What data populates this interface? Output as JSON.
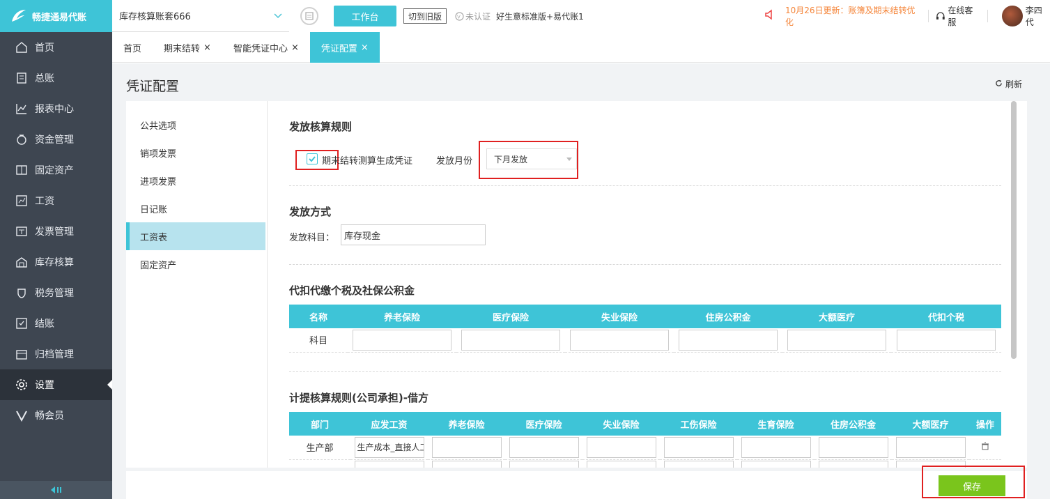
{
  "sidebar": {
    "logo_text": "畅捷通易代账",
    "items": [
      {
        "label": "首页",
        "icon": "home-icon"
      },
      {
        "label": "总账",
        "icon": "ledger-icon"
      },
      {
        "label": "报表中心",
        "icon": "chart-icon"
      },
      {
        "label": "资金管理",
        "icon": "money-bag-icon"
      },
      {
        "label": "固定资产",
        "icon": "asset-icon"
      },
      {
        "label": "工资",
        "icon": "salary-icon"
      },
      {
        "label": "发票管理",
        "icon": "invoice-icon"
      },
      {
        "label": "库存核算",
        "icon": "warehouse-icon"
      },
      {
        "label": "税务管理",
        "icon": "tax-icon"
      },
      {
        "label": "结账",
        "icon": "closing-icon"
      },
      {
        "label": "归档管理",
        "icon": "archive-icon"
      },
      {
        "label": "设置",
        "icon": "gear-icon"
      },
      {
        "label": "畅会员",
        "icon": "vip-icon"
      }
    ],
    "active_index": 11
  },
  "topbar": {
    "account_name": "库存核算账套666",
    "workbench_label": "工作台",
    "switch_old_label": "切到旧版",
    "unverified": "未认证",
    "plan": "好生意标准版+易代账1",
    "notice": "10月26日更新：账簿及期末结转优化",
    "online_service": "在线客服",
    "user_name": "李四代"
  },
  "tabs": [
    {
      "label": "首页",
      "closable": false
    },
    {
      "label": "期末结转",
      "closable": true
    },
    {
      "label": "智能凭证中心",
      "closable": true
    },
    {
      "label": "凭证配置",
      "closable": true,
      "active": true
    }
  ],
  "tab_close": "×",
  "page": {
    "title": "凭证配置",
    "refresh_label": "刷新"
  },
  "left_menu": [
    "公共选项",
    "销项发票",
    "进项发票",
    "日记账",
    "工资表",
    "固定资产"
  ],
  "left_menu_active": 4,
  "section1": {
    "title": "发放核算规则",
    "checkbox_label": "期末结转测算生成凭证",
    "checkbox_checked": true,
    "month_label": "发放月份",
    "month_value": "下月发放"
  },
  "section2": {
    "title": "发放方式",
    "subject_label": "发放科目：",
    "subject_value": "库存现金"
  },
  "section3": {
    "title": "代扣代缴个税及社保公积金",
    "headers": [
      "名称",
      "养老保险",
      "医疗保险",
      "失业保险",
      "住房公积金",
      "大额医疗",
      "代扣个税"
    ],
    "row_label": "科目"
  },
  "section4": {
    "title": "计提核算规则(公司承担)-借方",
    "headers": [
      "部门",
      "应发工资",
      "养老保险",
      "医疗保险",
      "失业保险",
      "工伤保险",
      "生育保险",
      "住房公积金",
      "大额医疗",
      "操作"
    ],
    "row1_dept": "生产部",
    "row1_salary": "生产成本_直接人工"
  },
  "save_label": "保存"
}
